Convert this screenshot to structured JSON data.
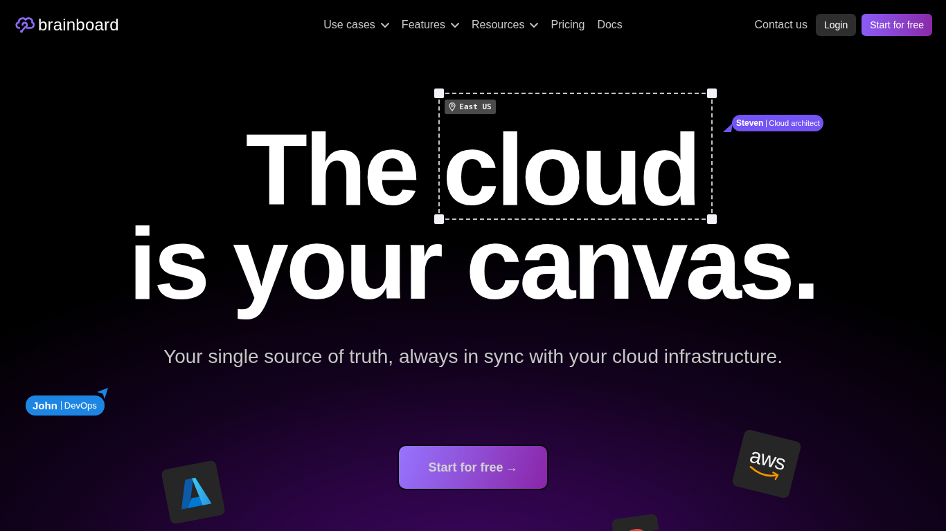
{
  "nav": {
    "logo": "brainboard",
    "links": [
      {
        "label": "Use cases",
        "kind": "menu"
      },
      {
        "label": "Features",
        "kind": "menu"
      },
      {
        "label": "Resources",
        "kind": "menu"
      },
      {
        "label": "Pricing",
        "kind": "link"
      },
      {
        "label": "Docs",
        "kind": "link"
      }
    ],
    "contact": "Contact us",
    "login": "Login",
    "signup": "Start for free"
  },
  "hero": {
    "headline_lines": [
      {
        "words": [
          {
            "text": "The",
            "selected": false
          },
          {
            "text": "cloud",
            "selected": true,
            "tag": "East US"
          }
        ]
      },
      {
        "words": [
          {
            "text": "is your canvas.",
            "selected": false
          }
        ]
      }
    ],
    "subtitle": "Your single source of truth, always in sync with your cloud infrastructure.",
    "cta": {
      "label": "Start for free",
      "arrow": "→"
    }
  },
  "cursors": [
    {
      "name": "Steven",
      "role": "Cloud architect",
      "color": "#7354f5"
    },
    {
      "name": "John",
      "role": "DevOps",
      "color": "#1d86e3"
    }
  ],
  "logo_tiles": [
    {
      "kind": "azure"
    },
    {
      "kind": "aws",
      "label": "aws"
    },
    {
      "kind": "partial"
    }
  ]
}
